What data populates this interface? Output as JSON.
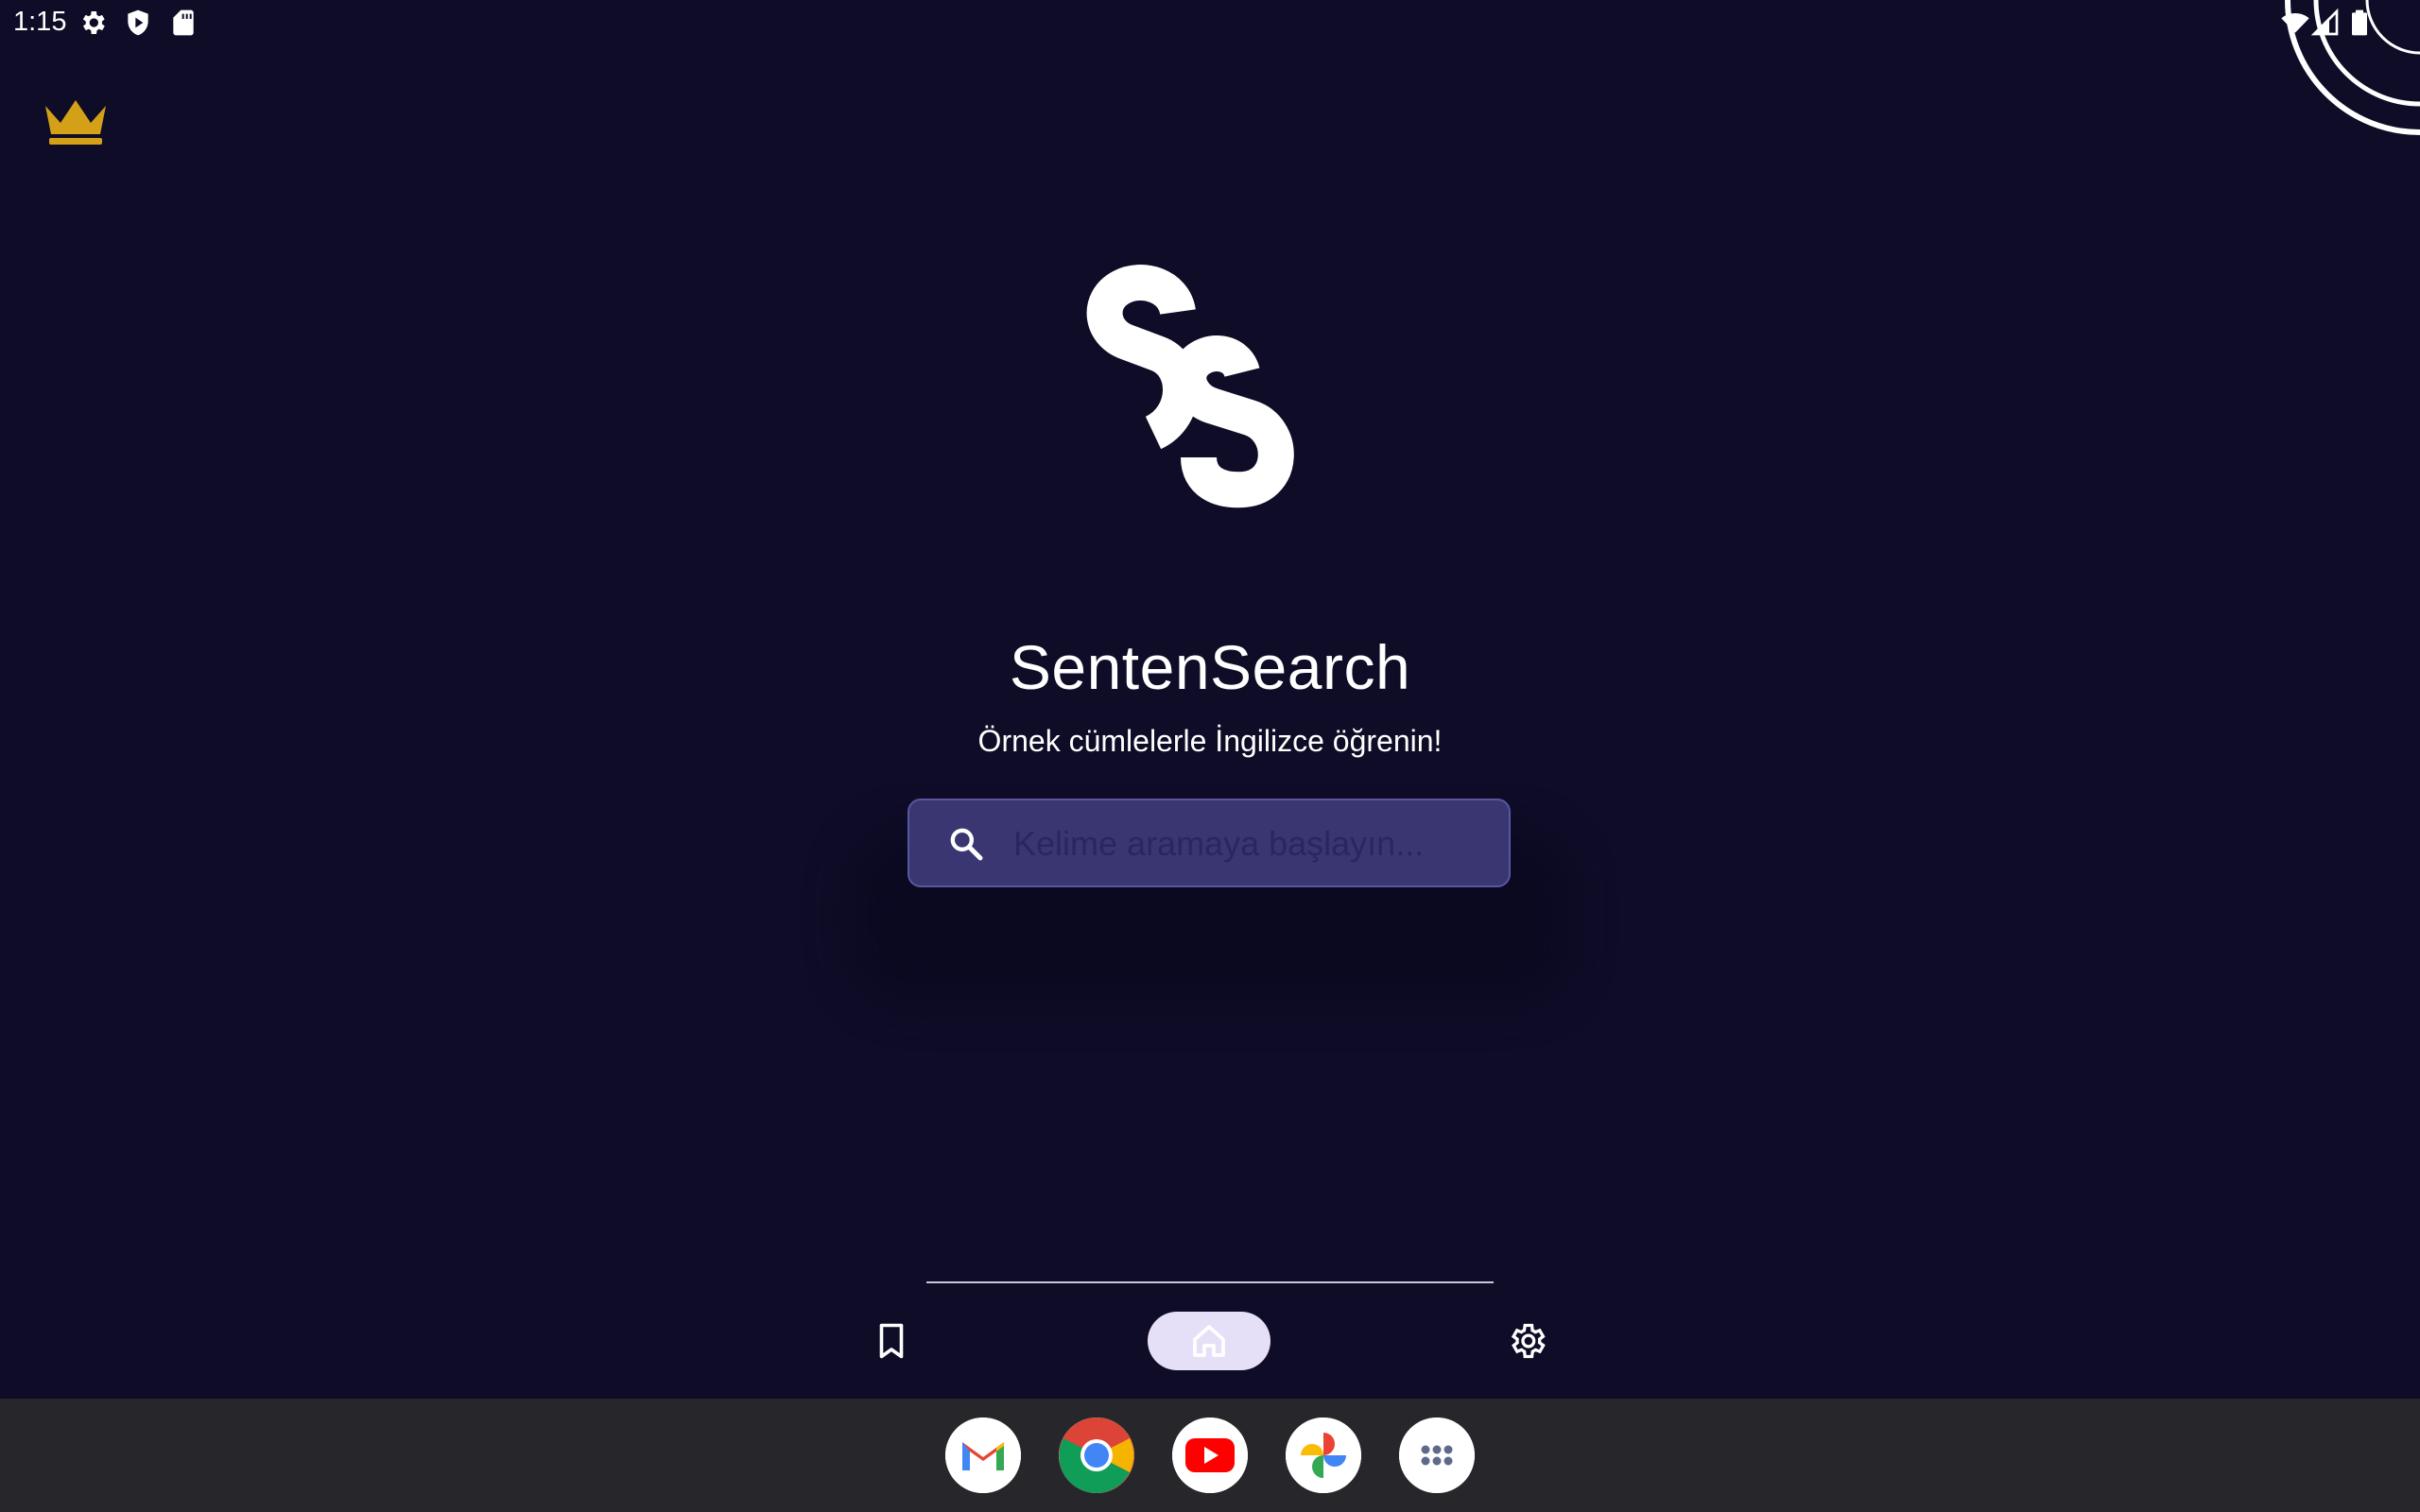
{
  "status_bar": {
    "time": "1:15",
    "left_icons": [
      "gear-icon",
      "play-protect-icon",
      "sd-card-icon"
    ],
    "right_icons": [
      "wifi-icon",
      "signal-icon",
      "battery-icon"
    ]
  },
  "header": {
    "premium_icon": "crown-icon",
    "crown_color": "#d4a017"
  },
  "hero": {
    "logo_text": "Ss",
    "title": "SentenSearch",
    "subtitle": "Örnek cümlelerle İngilizce öğrenin!"
  },
  "search": {
    "icon": "search-icon",
    "placeholder": "Kelime aramaya başlayın...",
    "value": ""
  },
  "bottom_nav": {
    "items": [
      {
        "id": "bookmarks",
        "icon": "bookmark-icon",
        "selected": false
      },
      {
        "id": "home",
        "icon": "home-icon",
        "selected": true
      },
      {
        "id": "settings",
        "icon": "gear-icon",
        "selected": false
      }
    ],
    "selected_indicator_color": "#e6dff8"
  },
  "dock": {
    "apps": [
      {
        "name": "Gmail",
        "icon": "gmail-icon"
      },
      {
        "name": "Chrome",
        "icon": "chrome-icon"
      },
      {
        "name": "YouTube",
        "icon": "youtube-icon"
      },
      {
        "name": "Photos",
        "icon": "photos-icon"
      },
      {
        "name": "Apps",
        "icon": "app-drawer-icon"
      }
    ]
  },
  "colors": {
    "background": "#0e0c27",
    "search_fill": "#3a3672",
    "dock_background": "#27272b"
  }
}
